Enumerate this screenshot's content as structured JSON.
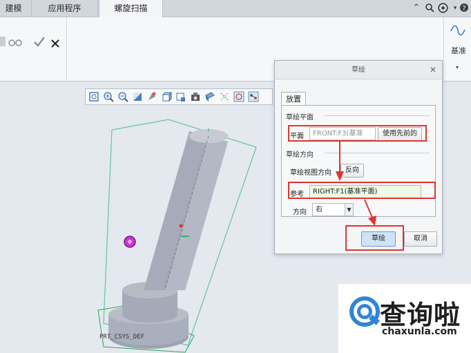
{
  "tabs": [
    {
      "label": "建模"
    },
    {
      "label": "应用程序"
    },
    {
      "label": "螺旋扫描"
    }
  ],
  "top_icons": [
    "caret-up-icon",
    "search-icon",
    "help-icon",
    "dropdown-icon"
  ],
  "ribbon": {
    "right_label": "基准",
    "left_icons": [
      "sketch-icon",
      "glasses-icon",
      "checkmark-icon",
      "close-icon"
    ]
  },
  "viewbar": {
    "icons": [
      "zoom-fit-icon",
      "zoom-in-icon",
      "zoom-out-icon",
      "repaint-icon",
      "reorient-icon",
      "display-style-icon",
      "saved-views-icon",
      "layers-icon",
      "view-manager-icon",
      "datum-display-icon",
      "spin-center-icon",
      "annotation-display-icon"
    ]
  },
  "model": {
    "csys_label": "PRT_CSYS_DEF"
  },
  "dialog": {
    "title": "草绘",
    "tab": "放置",
    "plane_group": "草绘平面",
    "plane_label": "平面",
    "plane_value": "FRONT:F3(基准",
    "use_previous_button": "使用先前的",
    "orient_group": "草绘方向",
    "view_dir_label": "草绘视图方向",
    "flip_button": "反向",
    "reference_label": "参考",
    "reference_value": "RIGHT:F1(基准平面)",
    "direction_label": "方向",
    "direction_value": "右",
    "sketch_button": "草绘",
    "cancel_button": "取消"
  },
  "watermark": {
    "logo_text": "查询啦",
    "url": "chaxunla.com"
  },
  "colors": {
    "highlight_red": "#e2332e",
    "selection_green": "#2bb673",
    "reference_green": "#eefae4",
    "sketch_button_blue": "#cfe3f5"
  }
}
